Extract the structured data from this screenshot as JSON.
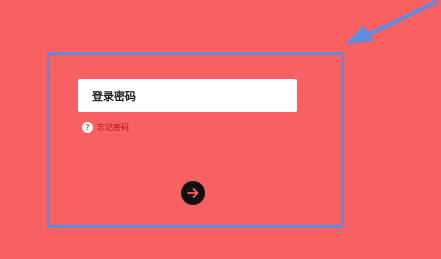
{
  "login": {
    "password_placeholder": "登录密码",
    "forgot_password_label": "忘记密码",
    "forgot_icon_glyph": "?",
    "next_button_icon": "arrow-right-icon"
  },
  "colors": {
    "background": "#f96061",
    "field_background": "#ffffff",
    "forgot_text": "#b80f16",
    "button_background": "#111111",
    "button_arrow": "#f96061",
    "annotation": "#5a8ee0"
  }
}
